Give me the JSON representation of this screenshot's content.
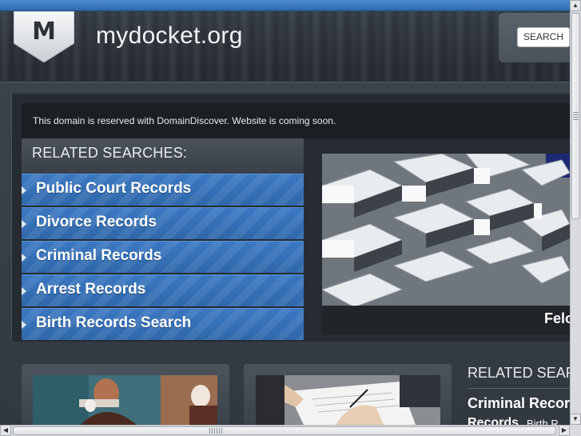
{
  "header": {
    "logo_letter": "M",
    "site_title": "mydocket.org",
    "search_label": "SEARCH"
  },
  "notice": {
    "text": "This domain is reserved with DomainDiscover. Website is coming soon."
  },
  "related_searches": {
    "title": "RELATED SEARCHES:",
    "items": [
      {
        "label": "Public Court Records"
      },
      {
        "label": "Divorce Records"
      },
      {
        "label": "Criminal Records"
      },
      {
        "label": "Arrest Records"
      },
      {
        "label": "Birth Records Search"
      }
    ]
  },
  "feature": {
    "caption": "Felo"
  },
  "related_searches_2": {
    "title": "RELATED SEAR",
    "item_1": "Criminal Recor",
    "item_2": "Records",
    "item_3": "Birth R"
  },
  "colors": {
    "accent_blue": "#3b78c2",
    "top_stripe": "#2d69ad",
    "background": "#2a3038"
  },
  "icons": {
    "logo": "shield-chevron-logo",
    "list_bullet": "triangle-right-icon"
  }
}
